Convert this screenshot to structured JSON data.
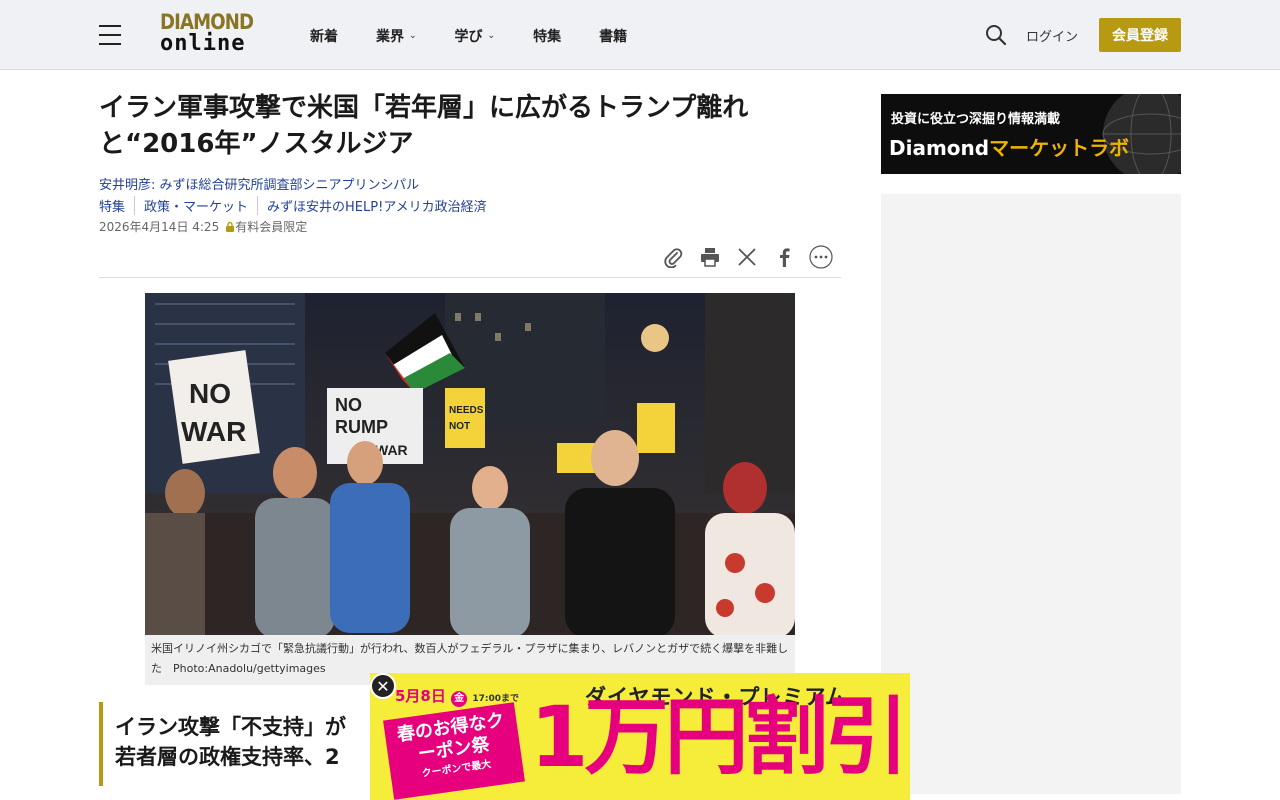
{
  "header": {
    "logo_top": "DIAMOND",
    "logo_bottom": "online",
    "nav": [
      {
        "label": "新着",
        "dropdown": false
      },
      {
        "label": "業界",
        "dropdown": true
      },
      {
        "label": "学び",
        "dropdown": true
      },
      {
        "label": "特集",
        "dropdown": false
      },
      {
        "label": "書籍",
        "dropdown": false
      }
    ],
    "login": "ログイン",
    "signup": "会員登録"
  },
  "article": {
    "title": "イラン軍事攻撃で米国「若年層」に広がるトランプ離れと“2016年”ノスタルジア",
    "author": "安井明彦: みずほ総合研究所調査部シニアプリンシパル",
    "tags": [
      "特集",
      "政策・マーケット",
      "みずほ安井のHELP!アメリカ政治経済"
    ],
    "date": "2026年4月14日 4:25",
    "member_only": "有料会員限定",
    "caption": "米国イリノイ州シカゴで「緊急抗議行動」が行われ、数百人がフェデラル・プラザに集まり、レバノンとガザで続く爆撃を非難した　Photo:Anadolu/gettyimages",
    "photo_signs": [
      "NO",
      "WAR",
      "NO",
      "RUMP",
      "NO",
      "WAR",
      "NEEDS",
      "NOT"
    ],
    "subheading_line1": "イラン攻撃「不支持」が",
    "subheading_line2": "若者層の政権支持率、2"
  },
  "sidebar": {
    "banner_top": "投資に役立つ深掘り情報満載",
    "banner_brand": "Diamond",
    "banner_brand_jp": "マーケットラボ"
  },
  "ad": {
    "date": "5月8日",
    "weekday": "金",
    "time": "17:00まで",
    "heading": "ダイヤモンド・プレミアム",
    "badge": "春のお得なクーポン祭",
    "badge_small": "クーポンで最大",
    "big": "1万円割引"
  },
  "colors": {
    "accent_gold": "#b89a12",
    "link_blue": "#23419a",
    "ad_pink": "#e6007e",
    "ad_yellow": "#f6ec3a"
  }
}
